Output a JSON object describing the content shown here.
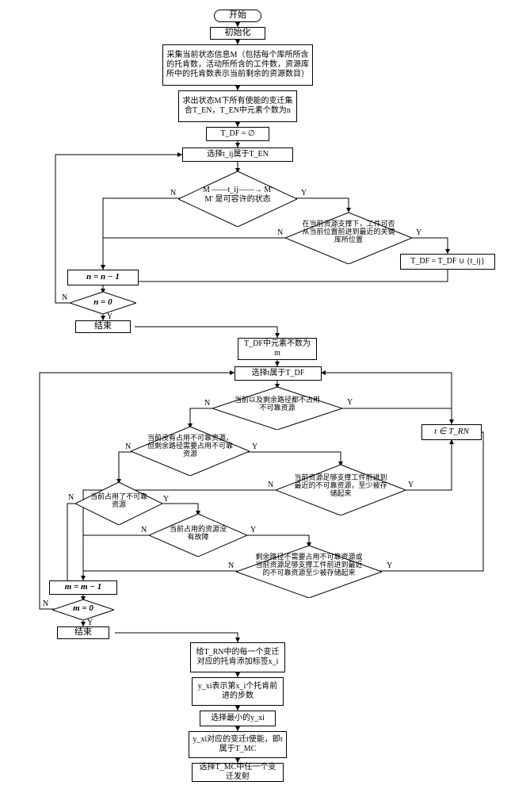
{
  "chart_data": {
    "type": "flowchart",
    "title": "",
    "nodes": [
      {
        "id": "start",
        "type": "terminal",
        "text": "开始"
      },
      {
        "id": "init",
        "type": "process",
        "text": "初始化"
      },
      {
        "id": "collect",
        "type": "process",
        "text": "采集当前状态信息M（包括每个库所所含的托肯数，活动所所含的工件数，资源库所中的托肯数表示当前剩余的资源数目）"
      },
      {
        "id": "solve",
        "type": "process",
        "text": "求出状态M下所有使能的变迁集合T_EN，T_EN中元素个数为n"
      },
      {
        "id": "tdf_empty",
        "type": "process",
        "text": "T_DF = ∅"
      },
      {
        "id": "select_tij",
        "type": "process",
        "text": "选择t_ij属于T_EN"
      },
      {
        "id": "decision1",
        "type": "decision",
        "text": "M —t_ij→ M'\nM' 是可容许的状态"
      },
      {
        "id": "decision2",
        "type": "decision",
        "text": "在当前资源支撑下，工件可否从当前位置前进到最近的关键库所位置"
      },
      {
        "id": "tdf_union",
        "type": "process",
        "text": "T_DF = T_DF ∪ {t_ij}"
      },
      {
        "id": "n_minus",
        "type": "process",
        "text": "n = n − 1"
      },
      {
        "id": "n_zero",
        "type": "decision",
        "text": "n = 0"
      },
      {
        "id": "end1",
        "type": "terminal",
        "text": "结束"
      },
      {
        "id": "tdf_m",
        "type": "process",
        "text": "T_DF中元素不数为m"
      },
      {
        "id": "select_t",
        "type": "process",
        "text": "选择t属于T_DF"
      },
      {
        "id": "dec_path",
        "type": "decision",
        "text": "当前以及剩余路径都不占用不可靠资源"
      },
      {
        "id": "dec_curr_none",
        "type": "decision",
        "text": "当前没有占用不可靠资源，但剩余路径需要占用不可靠资源"
      },
      {
        "id": "t_trn",
        "type": "process",
        "text": "t ∈ T_RN"
      },
      {
        "id": "dec_support",
        "type": "decision",
        "text": "当前资源足够支撑工件前进到最近的不可靠资源，至少被存储起来"
      },
      {
        "id": "dec_occupy",
        "type": "decision",
        "text": "当前占用了不可靠资源"
      },
      {
        "id": "dec_fault",
        "type": "decision",
        "text": "当前占用的资源没有故障"
      },
      {
        "id": "dec_remain",
        "type": "decision",
        "text": "剩余路径不需要占用不可靠资源或当前资源足够支撑工件前进到最近的不可靠资源至少被存储起来"
      },
      {
        "id": "m_minus",
        "type": "process",
        "text": "m = m − 1"
      },
      {
        "id": "m_zero",
        "type": "decision",
        "text": "m = 0"
      },
      {
        "id": "end2",
        "type": "terminal",
        "text": "结束"
      },
      {
        "id": "label_x",
        "type": "process",
        "text": "给T_RN中的每一个变迁对应的托肯添加标签x_i"
      },
      {
        "id": "yxi_def",
        "type": "process",
        "text": "y_xi表示第x_i个托肯前进的步数"
      },
      {
        "id": "select_min",
        "type": "process",
        "text": "选择最小的y_xi"
      },
      {
        "id": "yxi_t",
        "type": "process",
        "text": "y_xi对应的变迁t使能，即t属于T_MC"
      },
      {
        "id": "fire",
        "type": "process",
        "text": "选择T_MC中任一个变迁发射"
      }
    ]
  },
  "labels": {
    "start": "开始",
    "init": "初始化",
    "collect": "采集当前状态信息M（包括每个库所所含的托肯数，活动所所含的工件数，资源库所中的托肯数表示当前剩余的资源数目）",
    "solve": "求出状态M下所有使能的变迁集合T_EN，T_EN中元素个数为n",
    "tdf_empty": "T_DF = ∅",
    "select_tij": "选择t_ij属于T_EN",
    "d1a": "M ——t_ij——→ M'",
    "d1b": "M' 是可容许的状态",
    "d2": "在当前资源支撑下，工件可否从当前位置前进到最近的关键库所位置",
    "tdf_union": "T_DF = T_DF ∪ {t_ij}",
    "n_minus": "n = n − 1",
    "n_zero": "n = 0",
    "end1": "结束",
    "tdf_m": "T_DF中元素不数为m",
    "select_t": "选择t属于T_DF",
    "dec_path": "当前以及剩余路径都不占用不可靠资源",
    "dec_curr_none": "当前没有占用不可靠资源，但剩余路径需要占用不可靠资源",
    "t_trn": "t ∈ T_RN",
    "dec_support": "当前资源足够支撑工件前进到最近的不可靠资源，至少被存储起来",
    "dec_occupy": "当前占用了不可靠资源",
    "dec_fault": "当前占用的资源没有故障",
    "dec_remain": "剩余路径不需要占用不可靠资源或当前资源足够支撑工件前进到最近的不可靠资源至少被存储起来",
    "m_minus": "m = m − 1",
    "m_zero": "m = 0",
    "end2": "结束",
    "label_x": "给T_RN中的每一个变迁对应的托肯添加标签x_i",
    "yxi_def": "y_xi表示第x_i个托肯前进的步数",
    "select_min": "选择最小的y_xi",
    "yxi_t": "y_xi对应的变迁t使能，即t属于T_MC",
    "fire": "选择T_MC中任一个变迁发射",
    "Y": "Y",
    "N": "N"
  }
}
